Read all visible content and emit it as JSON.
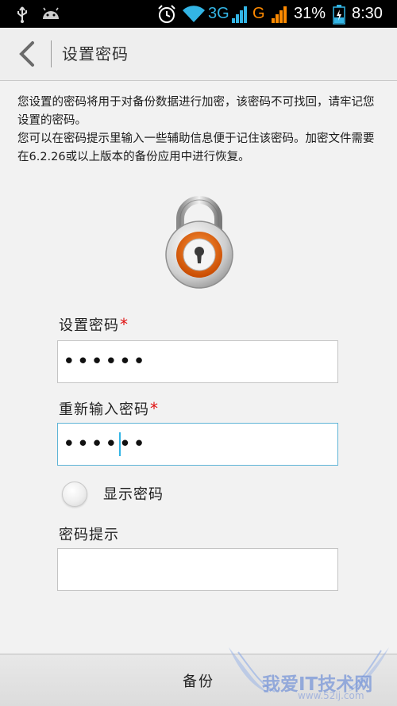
{
  "status_bar": {
    "network_3g": "3G",
    "network_g": "G",
    "battery": "31%",
    "time": "8:30",
    "icons": [
      "usb-icon",
      "android-icon",
      "alarm-icon",
      "wifi-icon",
      "signal-icon",
      "battery-icon"
    ]
  },
  "action_bar": {
    "title": "设置密码",
    "back_icon": "chevron-left-icon"
  },
  "description": {
    "line1": "您设置的密码将用于对备份数据进行加密，该密码不可找回，请牢记您设置的密码。",
    "line2": "您可以在密码提示里输入一些辅助信息便于记住该密码。加密文件需要在6.2.26或以上版本的备份应用中进行恢复。"
  },
  "form": {
    "password_label": "设置密码",
    "password_value": "••••••",
    "confirm_label": "重新输入密码",
    "confirm_value": "••••••",
    "required_mark": "*",
    "show_password_label": "显示密码",
    "show_password_checked": false,
    "hint_label": "密码提示",
    "hint_value": ""
  },
  "bottom": {
    "backup_label": "备份"
  },
  "watermark": {
    "text": "我爱IT技术网",
    "url": "www.52ij.com"
  },
  "colors": {
    "accent": "#33b5e5",
    "required": "#e01010",
    "lock_ring": "#e06010"
  }
}
